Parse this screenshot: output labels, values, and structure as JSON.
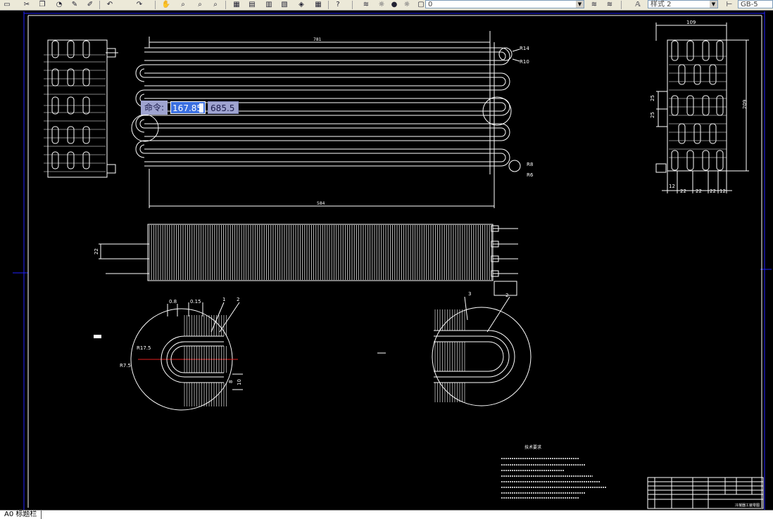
{
  "toolbar": {
    "icons": [
      "undo-icon",
      "redo-icon",
      "zoom-realtime-icon",
      "zoom-window-icon",
      "zoom-previous-icon",
      "pan-icon",
      "properties-icon",
      "design-center-icon",
      "tool-palettes-icon",
      "markup-icon",
      "calculator-icon",
      "help-icon",
      "layer-manager-icon",
      "layer-state-icon"
    ],
    "layer_value": "0",
    "style_value": "样式 2",
    "dimstyle_value": "GB-5"
  },
  "command_line": {
    "prompt": "命令:",
    "input1": "167.85",
    "input2": "685.5"
  },
  "drawing": {
    "dim_top": "781",
    "dim_bottom": "584",
    "r14": "R14",
    "r10": "R10",
    "r8": "R8",
    "r6": "R6",
    "side_width": "109",
    "side_height": "209",
    "side_25a": "25",
    "side_25b": "25",
    "side_12a": "12",
    "side_22a": "22",
    "side_22b": "22",
    "side_22c": "22",
    "side_12b": "12",
    "front_22": "22",
    "detail_08": "0.8",
    "detail_015": "0.15",
    "detail_1": "1",
    "detail_2": "2",
    "detail_r17": "R17.5",
    "detail_r7": "R7.5",
    "detail_8": "8",
    "detail_10": "10",
    "detail_3": "3",
    "detail_2b": "2",
    "notes_title": "技术要求",
    "title_block": "冷凝器工装零图"
  },
  "status": {
    "layout_tab": "A0 标题栏"
  }
}
